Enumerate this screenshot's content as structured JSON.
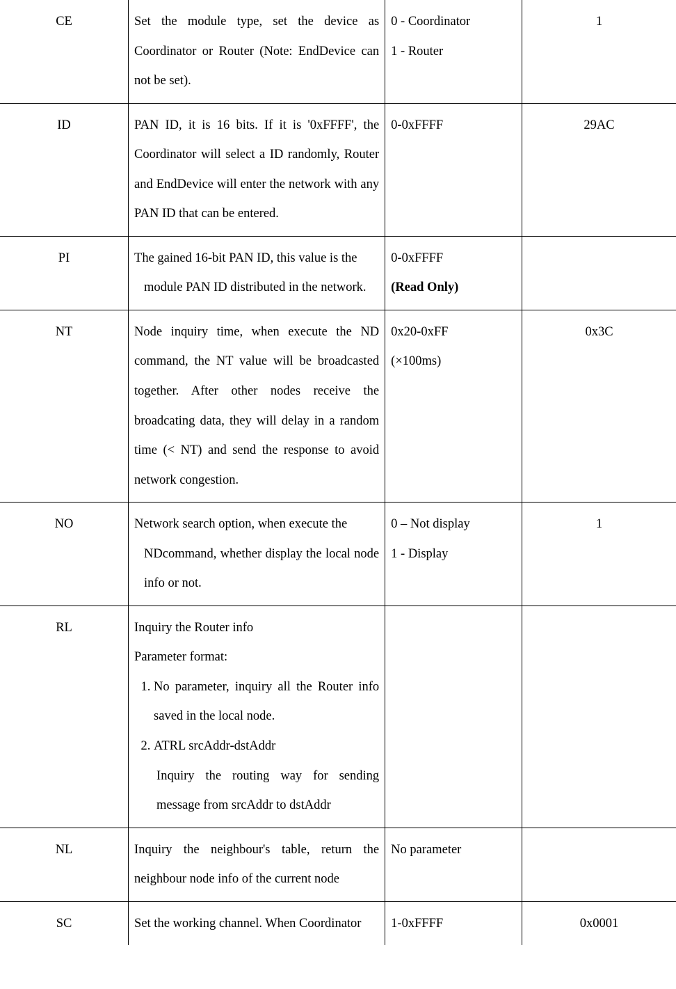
{
  "rows": [
    {
      "cmd": "CE",
      "desc": "Set the module type, set the device as Coordinator or Router (Note: EndDevice can not be set).",
      "range_line1": "0 - Coordinator",
      "range_line2": "1 - Router",
      "def": "1"
    },
    {
      "cmd": "ID",
      "desc": "PAN ID, it is 16 bits. If it is '0xFFFF', the Coordinator will select a ID randomly, Router and EndDevice will enter the network with any PAN ID that can be entered.",
      "range_line1": "0-0xFFFF",
      "def": "29AC"
    },
    {
      "cmd": "PI",
      "desc_pre": "The gained 16-bit PAN ID, this value is the",
      "desc_indent": "module PAN ID distributed in the network.",
      "range_line1": "0-0xFFFF",
      "range_line2_bold": "(Read Only)",
      "def": ""
    },
    {
      "cmd": "NT",
      "desc": "Node inquiry time, when execute the ND command, the NT value will be broadcasted together. After other nodes receive the broadcating data, they will delay in a random time (< NT) and send the response to avoid network congestion.",
      "range_line1": "0x20-0xFF",
      "range_line2": "(×100ms)",
      "def": "0x3C"
    },
    {
      "cmd": "NO",
      "desc_pre": "Network search option, when execute the",
      "desc_indent": "NDcommand, whether display the local node info or not.",
      "range_line1": "0 – Not display",
      "range_line2": "1 - Display",
      "def": "1"
    },
    {
      "cmd": "RL",
      "rl_line1": "Inquiry the Router info",
      "rl_line2": "Parameter format:",
      "rl_item1": "No parameter, inquiry all the Router info saved in the local node.",
      "rl_item2a": "ATRL srcAddr-dstAddr",
      "rl_item2b": "Inquiry the routing way for sending message from srcAddr to dstAddr",
      "range_line1": "",
      "def": ""
    },
    {
      "cmd": "NL",
      "desc": "Inquiry the neighbour's table, return the neighbour node info of the current node",
      "range_line1": "No parameter",
      "def": ""
    },
    {
      "cmd": "SC",
      "desc": "Set the working channel. When Coordinator",
      "range_line1": "1-0xFFFF",
      "def": "0x0001"
    }
  ]
}
